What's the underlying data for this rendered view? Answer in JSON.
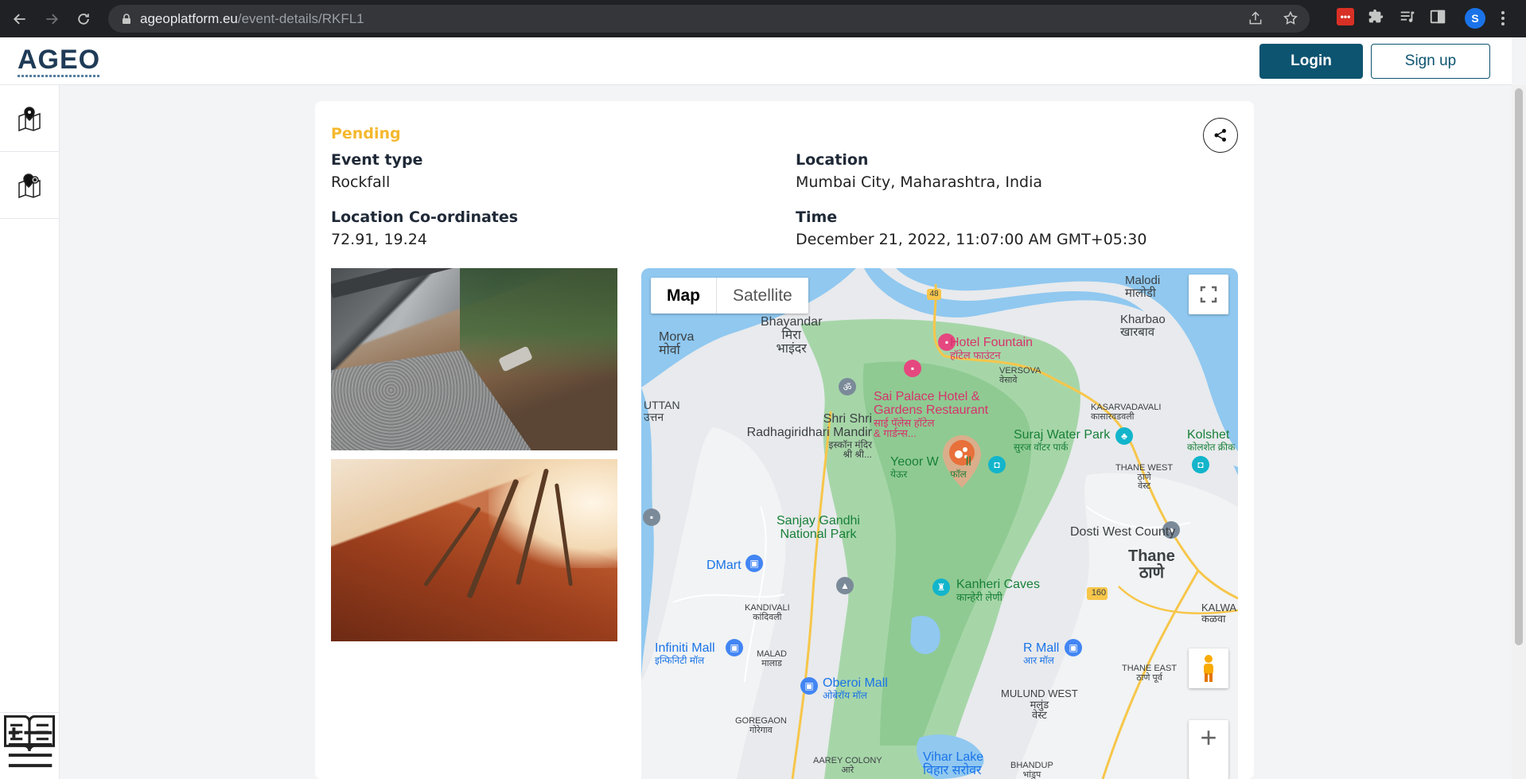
{
  "browser": {
    "url_host": "ageoplatform.eu",
    "url_path": "/event-details/RKFL1",
    "profile_initial": "S",
    "ext_label": "•••"
  },
  "header": {
    "logo_text": "AGEO",
    "login_label": "Login",
    "signup_label": "Sign up"
  },
  "event": {
    "status": "Pending",
    "event_type_label": "Event type",
    "event_type_value": "Rockfall",
    "location_label": "Location",
    "location_value": "Mumbai City, Maharashtra, India",
    "coords_label": "Location Co-ordinates",
    "coords_value": "72.91, 19.24",
    "time_label": "Time",
    "time_value": "December 21, 2022, 11:07:00 AM GMT+05:30"
  },
  "map": {
    "type_map": "Map",
    "type_satellite": "Satellite",
    "zoom_in": "+",
    "labels": {
      "malodi": "Malodi",
      "malodi_mr": "मालोडी",
      "kharbao": "Kharbao",
      "kharbao_mr": "खारबाव",
      "bhayandar": "Bhayandar",
      "bhayandar_mr": "मिरा",
      "bhayandar_mr2": "भाइंदर",
      "morva": "Morva",
      "morva_mr": "मोर्वा",
      "uttan": "UTTAN",
      "uttan_mr": "उत्तन",
      "hotel_fountain": "Hotel Fountain",
      "hotel_fountain_mr": "हॉटेल फाउंटन",
      "versova": "VERSOVA",
      "versova_mr": "वेसावे",
      "sai_palace_1": "Sai Palace Hotel &",
      "sai_palace_2": "Gardens Restaurant",
      "sai_palace_mr1": "साई पॅलेस हॉटेल",
      "sai_palace_mr2": "& गार्डन्स...",
      "kasarvadavali": "KASARVADAVALI",
      "kasarvadavali_mr": "कासारवडवली",
      "shri_shri_1": "Shri Shri",
      "shri_shri_2": "Radhagiridhari Mandir",
      "shri_shri_mr1": "इस्कॉन मंदिर",
      "shri_shri_mr2": "श्री श्री...",
      "suraj_water_park": "Suraj Water Park",
      "suraj_water_park_mr": "सुरज वॉटर पार्क",
      "kolshet": "Kolshet",
      "kolshet_mr": "कोलशेत क्रीक",
      "yeoor": "Yeoor W",
      "yeoor_tail": "ll",
      "yeoor_mr": "येऊर",
      "yeoor_mr_tail": "फॉल",
      "thane_west": "THANE WEST",
      "thane_west_mr": "ठाणे",
      "thane_west_mr2": "वेस्ट",
      "sanjay_gandhi_1": "Sanjay Gandhi",
      "sanjay_gandhi_2": "National Park",
      "dosti": "Dosti West County",
      "dmart": "DMart",
      "thane": "Thane",
      "thane_mr": "ठाणे",
      "route_160": "160",
      "route_48": "48",
      "kalwa": "KALWA",
      "kalwa_mr": "कळवा",
      "kanheri": "Kanheri Caves",
      "kanheri_mr": "कान्हेरी लेणी",
      "kandivali": "KANDIVALI",
      "kandivali_mr": "कांदिवली",
      "infiniti": "Infiniti Mall",
      "infiniti_mr": "इन्फिनिटी मॉल",
      "rmall": "R Mall",
      "rmall_mr": "आर मॉल",
      "malad": "MALAD",
      "malad_mr": "मालाड",
      "thane_east": "THANE EAST",
      "thane_east_mr": "ठाणे पूर्व",
      "oberoi": "Oberoi Mall",
      "oberoi_mr": "ओबेरॉय मॉल",
      "mulund_west": "MULUND WEST",
      "mulund_west_mr1": "मलुंड",
      "mulund_west_mr2": "वेस्ट",
      "goregaon": "GOREGAON",
      "goregaon_mr": "गोरेगाव",
      "aarey": "AAREY COLONY",
      "aarey_mr": "आरे",
      "vihar": "Vihar Lake",
      "vihar_mr": "विहार सरोवर",
      "bhandup": "BHANDUP",
      "bhandup_mr": "भांडुप"
    }
  },
  "colors": {
    "brand": "#0d5470",
    "pending": "#f5b82e",
    "marker": "#e8703a"
  }
}
